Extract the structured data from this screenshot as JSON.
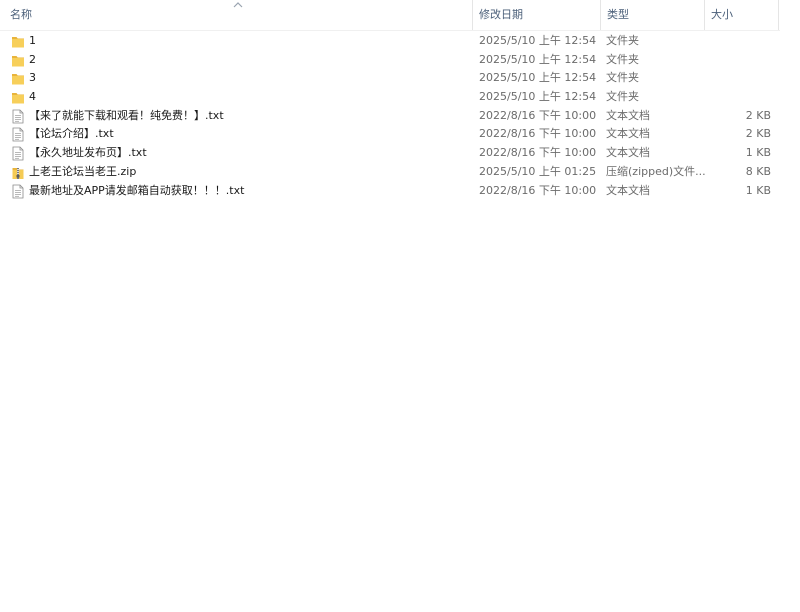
{
  "columns": {
    "name": "名称",
    "date": "修改日期",
    "type": "类型",
    "size": "大小"
  },
  "files": [
    {
      "name": "1",
      "date": "2025/5/10 上午 12:54",
      "type": "文件夹",
      "size": "",
      "icon": "folder-icon"
    },
    {
      "name": "2",
      "date": "2025/5/10 上午 12:54",
      "type": "文件夹",
      "size": "",
      "icon": "folder-icon"
    },
    {
      "name": "3",
      "date": "2025/5/10 上午 12:54",
      "type": "文件夹",
      "size": "",
      "icon": "folder-icon"
    },
    {
      "name": "4",
      "date": "2025/5/10 上午 12:54",
      "type": "文件夹",
      "size": "",
      "icon": "folder-icon"
    },
    {
      "name": "【来了就能下载和观看！纯免费！】.txt",
      "date": "2022/8/16 下午 10:00",
      "type": "文本文档",
      "size": "2 KB",
      "icon": "text-file-icon"
    },
    {
      "name": "【论坛介绍】.txt",
      "date": "2022/8/16 下午 10:00",
      "type": "文本文档",
      "size": "2 KB",
      "icon": "text-file-icon"
    },
    {
      "name": "【永久地址发布页】.txt",
      "date": "2022/8/16 下午 10:00",
      "type": "文本文档",
      "size": "1 KB",
      "icon": "text-file-icon"
    },
    {
      "name": "上老王论坛当老王.zip",
      "date": "2025/5/10 上午 01:25",
      "type": "压缩(zipped)文件...",
      "size": "8 KB",
      "icon": "zip-file-icon"
    },
    {
      "name": "最新地址及APP请发邮箱自动获取！！！.txt",
      "date": "2022/8/16 下午 10:00",
      "type": "文本文档",
      "size": "1 KB",
      "icon": "text-file-icon"
    }
  ],
  "colors": {
    "header_text": "#4c607a",
    "folder": "#f3c74f",
    "secondary_text": "#6b6b6b"
  }
}
